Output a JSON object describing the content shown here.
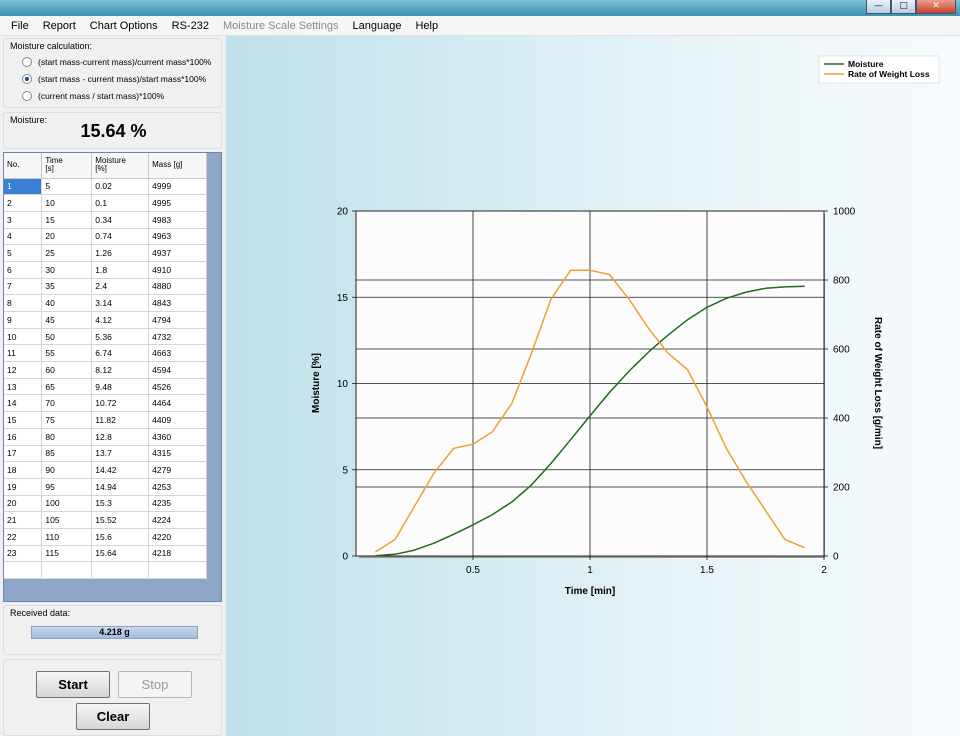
{
  "window": {
    "buttons": [
      "—",
      "□",
      "✕"
    ]
  },
  "menu": {
    "items": [
      {
        "label": "File",
        "disabled": false
      },
      {
        "label": "Report",
        "disabled": false
      },
      {
        "label": "Chart Options",
        "disabled": false
      },
      {
        "label": "RS-232",
        "disabled": false
      },
      {
        "label": "Moisture Scale Settings",
        "disabled": true
      },
      {
        "label": "Language",
        "disabled": false
      },
      {
        "label": "Help",
        "disabled": false
      }
    ]
  },
  "calculation": {
    "title": "Moisture calculation:",
    "options": [
      {
        "label": "(start mass-current mass)/current mass*100%",
        "checked": false
      },
      {
        "label": "(start mass - current mass)/start mass*100%",
        "checked": true
      },
      {
        "label": "(current mass / start mass)*100%",
        "checked": false
      }
    ]
  },
  "moisture": {
    "title": "Moisture:",
    "value": "15.64 %"
  },
  "table": {
    "headers": [
      {
        "line1": "No.",
        "line2": ""
      },
      {
        "line1": "Time",
        "line2": "[s]"
      },
      {
        "line1": "Moisture",
        "line2": "[%]"
      },
      {
        "line1": "Mass [g]",
        "line2": ""
      }
    ],
    "rows": [
      [
        "1",
        "5",
        "0.02",
        "4999"
      ],
      [
        "2",
        "10",
        "0.1",
        "4995"
      ],
      [
        "3",
        "15",
        "0.34",
        "4983"
      ],
      [
        "4",
        "20",
        "0.74",
        "4963"
      ],
      [
        "5",
        "25",
        "1.26",
        "4937"
      ],
      [
        "6",
        "30",
        "1.8",
        "4910"
      ],
      [
        "7",
        "35",
        "2.4",
        "4880"
      ],
      [
        "8",
        "40",
        "3.14",
        "4843"
      ],
      [
        "9",
        "45",
        "4.12",
        "4794"
      ],
      [
        "10",
        "50",
        "5.36",
        "4732"
      ],
      [
        "11",
        "55",
        "6.74",
        "4663"
      ],
      [
        "12",
        "60",
        "8.12",
        "4594"
      ],
      [
        "13",
        "65",
        "9.48",
        "4526"
      ],
      [
        "14",
        "70",
        "10.72",
        "4464"
      ],
      [
        "15",
        "75",
        "11.82",
        "4409"
      ],
      [
        "16",
        "80",
        "12.8",
        "4360"
      ],
      [
        "17",
        "85",
        "13.7",
        "4315"
      ],
      [
        "18",
        "90",
        "14.42",
        "4279"
      ],
      [
        "19",
        "95",
        "14.94",
        "4253"
      ],
      [
        "20",
        "100",
        "15.3",
        "4235"
      ],
      [
        "21",
        "105",
        "15.52",
        "4224"
      ],
      [
        "22",
        "110",
        "15.6",
        "4220"
      ],
      [
        "23",
        "115",
        "15.64",
        "4218"
      ]
    ],
    "selected_row": 0
  },
  "received": {
    "title": "Received data:",
    "value": "4.218 g"
  },
  "buttons": {
    "start": "Start",
    "stop": "Stop",
    "clear": "Clear"
  },
  "chart_data": {
    "type": "line",
    "xlabel": "Time [min]",
    "ylabel": "Moisture [%]",
    "y2label": "Rate of Weight Loss [g/min]",
    "xlim": [
      0,
      2
    ],
    "ylim": [
      0,
      20
    ],
    "y2lim": [
      0,
      1000
    ],
    "xticks": [
      "0.5",
      "1",
      "1.5",
      "2"
    ],
    "yticks": [
      "0",
      "5",
      "10",
      "15",
      "20"
    ],
    "y2ticks": [
      "0",
      "200",
      "400",
      "600",
      "800",
      "1000"
    ],
    "legend_position": "top-right",
    "grid": true,
    "series": [
      {
        "name": "Moisture",
        "axis": "left",
        "color": "#1e6b1e",
        "x": [
          0.083,
          0.167,
          0.25,
          0.333,
          0.417,
          0.5,
          0.583,
          0.667,
          0.75,
          0.833,
          0.917,
          1.0,
          1.083,
          1.167,
          1.25,
          1.333,
          1.417,
          1.5,
          1.583,
          1.667,
          1.75,
          1.833,
          1.917
        ],
        "y": [
          0.02,
          0.1,
          0.34,
          0.74,
          1.26,
          1.8,
          2.4,
          3.14,
          4.12,
          5.36,
          6.74,
          8.12,
          9.48,
          10.72,
          11.82,
          12.8,
          13.7,
          14.42,
          14.94,
          15.3,
          15.52,
          15.6,
          15.64
        ]
      },
      {
        "name": "Rate of Weight Loss",
        "axis": "right",
        "color": "#f0a030",
        "x": [
          0.083,
          0.167,
          0.25,
          0.333,
          0.417,
          0.5,
          0.583,
          0.667,
          0.75,
          0.833,
          0.917,
          1.0,
          1.083,
          1.167,
          1.25,
          1.333,
          1.417,
          1.5,
          1.583,
          1.667,
          1.75,
          1.833,
          1.917
        ],
        "y": [
          12,
          48,
          144,
          240,
          312,
          324,
          360,
          444,
          588,
          744,
          828,
          828,
          816,
          744,
          660,
          588,
          540,
          432,
          312,
          216,
          132,
          48,
          24
        ]
      }
    ]
  }
}
